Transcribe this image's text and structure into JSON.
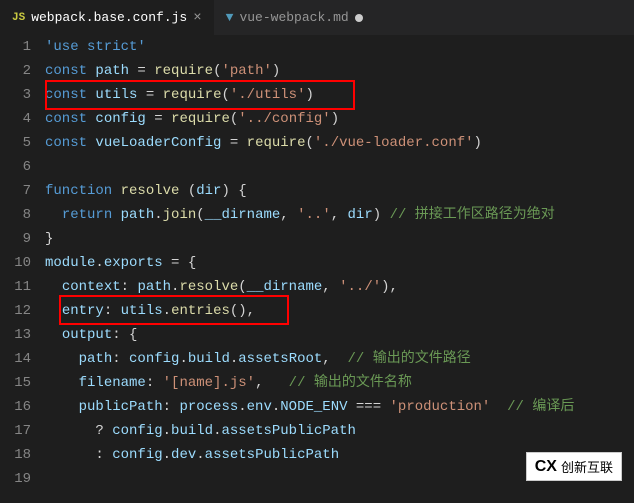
{
  "tabs": [
    {
      "icon": "JS",
      "label": "webpack.base.conf.js",
      "active": true,
      "dirty": false
    },
    {
      "icon": "▼",
      "label": "vue-webpack.md",
      "active": false,
      "dirty": true
    }
  ],
  "lines": {
    "count": 19,
    "content": [
      {
        "n": 1,
        "segs": [
          [
            "kw",
            "'use strict'"
          ]
        ]
      },
      {
        "n": 2,
        "segs": [
          [
            "kw",
            "const"
          ],
          [
            "pn",
            " "
          ],
          [
            "id",
            "path"
          ],
          [
            "pn",
            " = "
          ],
          [
            "fn",
            "require"
          ],
          [
            "pn",
            "("
          ],
          [
            "str",
            "'path'"
          ],
          [
            "pn",
            ")"
          ]
        ]
      },
      {
        "n": 3,
        "segs": [
          [
            "kw",
            "const"
          ],
          [
            "pn",
            " "
          ],
          [
            "id",
            "utils"
          ],
          [
            "pn",
            " = "
          ],
          [
            "fn",
            "require"
          ],
          [
            "pn",
            "("
          ],
          [
            "str",
            "'./utils'"
          ],
          [
            "pn",
            ")"
          ]
        ]
      },
      {
        "n": 4,
        "segs": [
          [
            "kw",
            "const"
          ],
          [
            "pn",
            " "
          ],
          [
            "id",
            "config"
          ],
          [
            "pn",
            " = "
          ],
          [
            "fn",
            "require"
          ],
          [
            "pn",
            "("
          ],
          [
            "str",
            "'../config'"
          ],
          [
            "pn",
            ")"
          ]
        ]
      },
      {
        "n": 5,
        "segs": [
          [
            "kw",
            "const"
          ],
          [
            "pn",
            " "
          ],
          [
            "id",
            "vueLoaderConfig"
          ],
          [
            "pn",
            " = "
          ],
          [
            "fn",
            "require"
          ],
          [
            "pn",
            "("
          ],
          [
            "str",
            "'./vue-loader.conf'"
          ],
          [
            "pn",
            ")"
          ]
        ]
      },
      {
        "n": 6,
        "segs": []
      },
      {
        "n": 7,
        "segs": [
          [
            "kw",
            "function"
          ],
          [
            "pn",
            " "
          ],
          [
            "fn",
            "resolve"
          ],
          [
            "pn",
            " ("
          ],
          [
            "id",
            "dir"
          ],
          [
            "pn",
            ") {"
          ]
        ]
      },
      {
        "n": 8,
        "segs": [
          [
            "pn",
            "  "
          ],
          [
            "kw",
            "return"
          ],
          [
            "pn",
            " "
          ],
          [
            "id",
            "path"
          ],
          [
            "pn",
            "."
          ],
          [
            "fn",
            "join"
          ],
          [
            "pn",
            "("
          ],
          [
            "id",
            "__dirname"
          ],
          [
            "pn",
            ", "
          ],
          [
            "str",
            "'..'"
          ],
          [
            "pn",
            ", "
          ],
          [
            "id",
            "dir"
          ],
          [
            "pn",
            ") "
          ],
          [
            "cm",
            "// 拼接工作区路径为绝对"
          ]
        ]
      },
      {
        "n": 9,
        "segs": [
          [
            "pn",
            "}"
          ]
        ]
      },
      {
        "n": 10,
        "segs": [
          [
            "id",
            "module"
          ],
          [
            "pn",
            "."
          ],
          [
            "id",
            "exports"
          ],
          [
            "pn",
            " = {"
          ]
        ]
      },
      {
        "n": 11,
        "segs": [
          [
            "pn",
            "  "
          ],
          [
            "id",
            "context"
          ],
          [
            "pn",
            ": "
          ],
          [
            "id",
            "path"
          ],
          [
            "pn",
            "."
          ],
          [
            "fn",
            "resolve"
          ],
          [
            "pn",
            "("
          ],
          [
            "id",
            "__dirname"
          ],
          [
            "pn",
            ", "
          ],
          [
            "str",
            "'../'"
          ],
          [
            "pn",
            "),"
          ]
        ]
      },
      {
        "n": 12,
        "segs": [
          [
            "pn",
            "  "
          ],
          [
            "id",
            "entry"
          ],
          [
            "pn",
            ": "
          ],
          [
            "id",
            "utils"
          ],
          [
            "pn",
            "."
          ],
          [
            "fn",
            "entries"
          ],
          [
            "pn",
            "(),"
          ]
        ]
      },
      {
        "n": 13,
        "segs": [
          [
            "pn",
            "  "
          ],
          [
            "id",
            "output"
          ],
          [
            "pn",
            ": {"
          ]
        ]
      },
      {
        "n": 14,
        "segs": [
          [
            "pn",
            "    "
          ],
          [
            "id",
            "path"
          ],
          [
            "pn",
            ": "
          ],
          [
            "id",
            "config"
          ],
          [
            "pn",
            "."
          ],
          [
            "id",
            "build"
          ],
          [
            "pn",
            "."
          ],
          [
            "id",
            "assetsRoot"
          ],
          [
            "pn",
            ",  "
          ],
          [
            "cm",
            "// 输出的文件路径"
          ]
        ]
      },
      {
        "n": 15,
        "segs": [
          [
            "pn",
            "    "
          ],
          [
            "id",
            "filename"
          ],
          [
            "pn",
            ": "
          ],
          [
            "str",
            "'[name].js'"
          ],
          [
            "pn",
            ",   "
          ],
          [
            "cm",
            "// 输出的文件名称"
          ]
        ]
      },
      {
        "n": 16,
        "segs": [
          [
            "pn",
            "    "
          ],
          [
            "id",
            "publicPath"
          ],
          [
            "pn",
            ": "
          ],
          [
            "id",
            "process"
          ],
          [
            "pn",
            "."
          ],
          [
            "id",
            "env"
          ],
          [
            "pn",
            "."
          ],
          [
            "id",
            "NODE_ENV"
          ],
          [
            "pn",
            " === "
          ],
          [
            "str",
            "'production'"
          ],
          [
            "pn",
            "  "
          ],
          [
            "cm",
            "// 编译后"
          ]
        ]
      },
      {
        "n": 17,
        "segs": [
          [
            "pn",
            "      ? "
          ],
          [
            "id",
            "config"
          ],
          [
            "pn",
            "."
          ],
          [
            "id",
            "build"
          ],
          [
            "pn",
            "."
          ],
          [
            "id",
            "assetsPublicPath"
          ]
        ]
      },
      {
        "n": 18,
        "segs": [
          [
            "pn",
            "      : "
          ],
          [
            "id",
            "config"
          ],
          [
            "pn",
            "."
          ],
          [
            "id",
            "dev"
          ],
          [
            "pn",
            "."
          ],
          [
            "id",
            "assetsPublicPath"
          ]
        ]
      }
    ]
  },
  "watermark": {
    "logo": "CX",
    "text": "创新互联"
  }
}
